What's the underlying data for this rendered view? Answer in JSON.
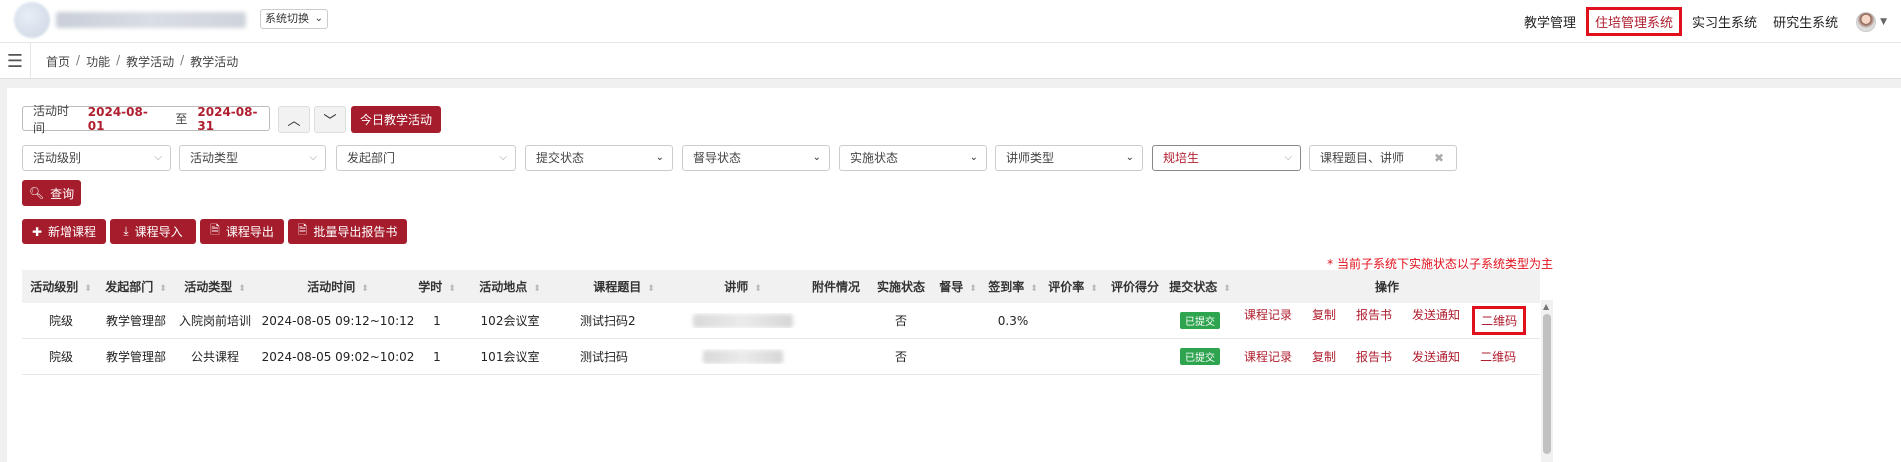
{
  "header": {
    "system_switch": "系统切换",
    "nav": [
      "教学管理",
      "住培管理系统",
      "实习生系统",
      "研究生系统"
    ],
    "active_nav": "住培管理系统"
  },
  "breadcrumb": [
    "首页",
    "功能",
    "教学活动",
    "教学活动"
  ],
  "filters": {
    "date_label": "活动时间",
    "date_start": "2024-08-01",
    "date_sep": "至",
    "date_end": "2024-08-31",
    "today_button": "今日教学活动",
    "selects": [
      "活动级别",
      "活动类型",
      "发起部门",
      "提交状态",
      "督导状态",
      "实施状态",
      "讲师类型",
      "规培生"
    ],
    "search_placeholder": "课程题目、讲师",
    "query_button": "查询"
  },
  "actions": [
    "新增课程",
    "课程导入",
    "课程导出",
    "批量导出报告书"
  ],
  "note": "* 当前子系统下实施状态以子系统类型为主",
  "table": {
    "headers": [
      "活动级别",
      "发起部门",
      "活动类型",
      "活动时间",
      "学时",
      "活动地点",
      "课程题目",
      "讲师",
      "附件情况",
      "实施状态",
      "督导",
      "签到率",
      "评价率",
      "评价得分",
      "提交状态",
      "操作"
    ],
    "rows": [
      {
        "level": "院级",
        "dept": "教学管理部",
        "type": "入院岗前培训",
        "time": "2024-08-05 09:12~10:12",
        "hours": "1",
        "place": "102会议室",
        "title": "测试扫码2",
        "attach": "",
        "impl": "否",
        "supervise": "",
        "checkin": "0.3%",
        "eval_rate": "",
        "eval_score": "",
        "status": "已提交",
        "ops": [
          "课程记录",
          "复制",
          "报告书",
          "发送通知",
          "二维码"
        ]
      },
      {
        "level": "院级",
        "dept": "教学管理部",
        "type": "公共课程",
        "time": "2024-08-05 09:02~10:02",
        "hours": "1",
        "place": "101会议室",
        "title": "测试扫码",
        "attach": "",
        "impl": "否",
        "supervise": "",
        "checkin": "",
        "eval_rate": "",
        "eval_score": "",
        "status": "已提交",
        "ops": [
          "课程记录",
          "复制",
          "报告书",
          "发送通知",
          "二维码"
        ]
      }
    ]
  },
  "colors": {
    "brand_red": "#a51d2d",
    "highlight_red": "#e0101c",
    "badge_green": "#2ea44f"
  }
}
